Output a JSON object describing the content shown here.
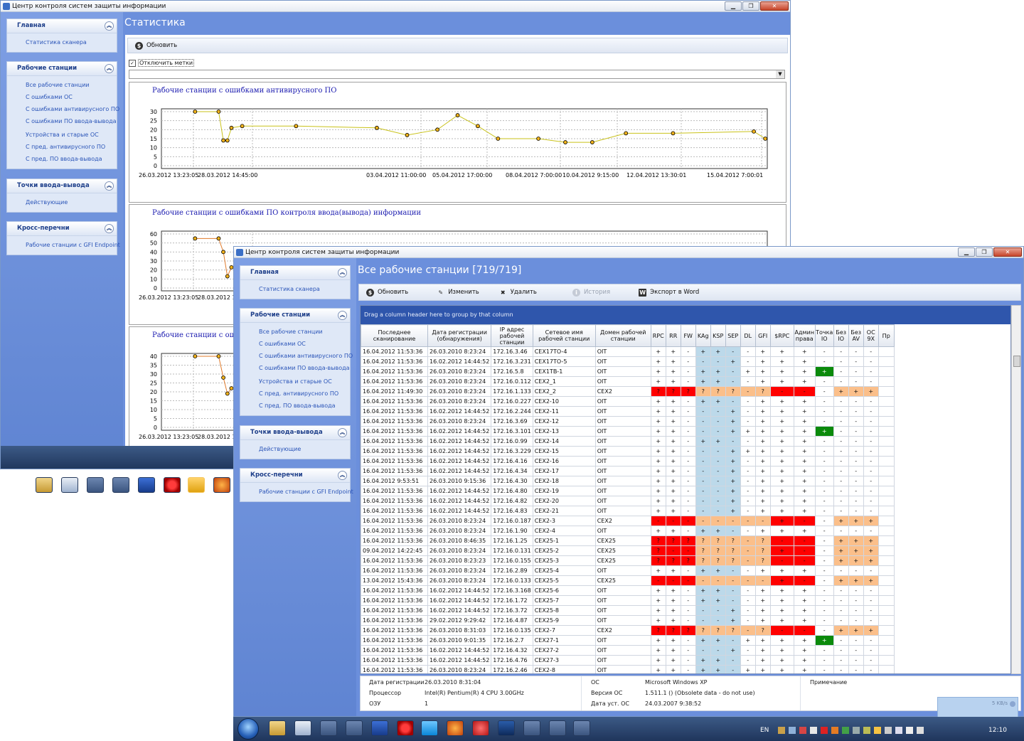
{
  "back_window": {
    "title": "Центр контроля систем защиты информации",
    "page_title": "Статистика",
    "toolbar": {
      "refresh": "Обновить"
    },
    "checkbox_label": "Отключить метки",
    "charts": [
      {
        "title": "Рабочие станции с ошибками антивирусного ПО",
        "y_ticks": [
          "30",
          "25",
          "20",
          "15",
          "10",
          "5",
          "0"
        ],
        "x_labels": [
          "26.03.2012 13:23:05",
          "28.03.2012 14:45:00",
          "03.04.2012 11:00:00",
          "05.04.2012 17:00:00",
          "08.04.2012 7:00:00",
          "10.04.2012 9:15:00",
          "12.04.2012 13:30:01",
          "15.04.2012 7:00:01"
        ]
      },
      {
        "title": "Рабочие станции с ошибками ПО контроля ввода(вывода) информации",
        "y_ticks": [
          "60",
          "50",
          "40",
          "30",
          "20",
          "10",
          "0"
        ],
        "x_labels": [
          "26.03.2012 13:23:05",
          "28.03.2012 14:4"
        ]
      },
      {
        "title": "Рабочие станции с ошиб",
        "y_ticks": [
          "40",
          "35",
          "30",
          "25",
          "20",
          "15",
          "10",
          "5",
          "0"
        ],
        "x_labels": [
          "26.03.2012 13:23:05",
          "28.03.2012 14:4"
        ]
      }
    ]
  },
  "sidebar": {
    "groups": [
      {
        "title": "Главная",
        "items": [
          "Статистика сканера"
        ]
      },
      {
        "title": "Рабочие станции",
        "items": [
          "Все рабочие станции",
          "С ошибками ОС",
          "С ошибками антивирусного ПО",
          "С ошибками ПО ввода-вывода",
          "Устройства и старые ОС",
          "С пред. антивирусного ПО",
          "С пред. ПО ввода-вывода"
        ]
      },
      {
        "title": "Точки ввода-вывода",
        "items": [
          "Действующие"
        ]
      },
      {
        "title": "Кросс-перечни",
        "items": [
          "Рабочие станции с GFI Endpoint"
        ]
      }
    ]
  },
  "front_window": {
    "title": "Центр контроля систем защиты информации",
    "page_title": "Все рабочие станции [719/719]",
    "toolbar": {
      "refresh": "Обновить",
      "edit": "Изменить",
      "delete": "Удалить",
      "history": "История",
      "export": "Экспорт в Word"
    },
    "group_hint": "Drag a column header here to group by that column",
    "columns": [
      "Последнее сканирование",
      "Дата регистрации (обнаружения)",
      "IP адрес рабочей станции",
      "Сетевое имя рабочей станции",
      "Домен рабочей станции",
      "RPC",
      "RR",
      "FW",
      "KAg",
      "KSP",
      "SEP",
      "DL",
      "GFI",
      "$RPC",
      "Админ права",
      "Точка IO",
      "Без IO",
      "Без AV",
      "ОС 9X",
      "Пр"
    ],
    "rows": [
      [
        "16.04.2012 11:53:36",
        "26.03.2010 8:23:24",
        "172.16.3.46",
        "CEX17TO-4",
        "OIT",
        "+",
        "+",
        "-",
        "+",
        "+",
        "-",
        "-",
        "+",
        "+",
        "+",
        "-",
        "-",
        "-",
        "-",
        "",
        "n"
      ],
      [
        "16.04.2012 11:53:36",
        "16.02.2012 14:44:52",
        "172.16.3.231",
        "CEX17TO-5",
        "OIT",
        "+",
        "+",
        "-",
        "-",
        "-",
        "+",
        "-",
        "+",
        "+",
        "+",
        "-",
        "-",
        "-",
        "-",
        "",
        "n"
      ],
      [
        "16.04.2012 11:53:36",
        "26.03.2010 8:23:24",
        "172.16.5.8",
        "CEX1TB-1",
        "OIT",
        "+",
        "+",
        "-",
        "+",
        "+",
        "-",
        "+",
        "+",
        "+",
        "+",
        "+",
        "-",
        "-",
        "-",
        "",
        "g"
      ],
      [
        "16.04.2012 11:53:36",
        "26.03.2010 8:23:24",
        "172.16.0.112",
        "CEX2_1",
        "OIT",
        "+",
        "+",
        "-",
        "+",
        "+",
        "-",
        "-",
        "+",
        "+",
        "+",
        "-",
        "-",
        "-",
        "-",
        "",
        "n"
      ],
      [
        "16.04.2012 11:49:30",
        "26.03.2010 8:23:24",
        "172.16.1.133",
        "CEX2_2",
        "CEX2",
        "?",
        "?",
        "?",
        "?",
        "?",
        "?",
        "-",
        "?",
        "-",
        "-",
        "-",
        "+",
        "+",
        "+",
        "",
        "r"
      ],
      [
        "16.04.2012 11:53:36",
        "26.03.2010 8:23:24",
        "172.16.0.227",
        "CEX2-10",
        "OIT",
        "+",
        "+",
        "-",
        "+",
        "+",
        "-",
        "-",
        "+",
        "+",
        "+",
        "-",
        "-",
        "-",
        "-",
        "",
        "n"
      ],
      [
        "16.04.2012 11:53:36",
        "16.02.2012 14:44:52",
        "172.16.2.244",
        "CEX2-11",
        "OIT",
        "+",
        "+",
        "-",
        "-",
        "-",
        "+",
        "-",
        "+",
        "+",
        "+",
        "-",
        "-",
        "-",
        "-",
        "",
        "n"
      ],
      [
        "16.04.2012 11:53:36",
        "26.03.2010 8:23:24",
        "172.16.3.69",
        "CEX2-12",
        "OIT",
        "+",
        "+",
        "-",
        "-",
        "-",
        "+",
        "-",
        "+",
        "+",
        "+",
        "-",
        "-",
        "-",
        "-",
        "",
        "n"
      ],
      [
        "16.04.2012 11:53:36",
        "16.02.2012 14:44:52",
        "172.16.3.101",
        "CEX2-13",
        "OIT",
        "+",
        "+",
        "-",
        "-",
        "-",
        "+",
        "+",
        "+",
        "+",
        "+",
        "+",
        "-",
        "-",
        "-",
        "",
        "g"
      ],
      [
        "16.04.2012 11:53:36",
        "16.02.2012 14:44:52",
        "172.16.0.99",
        "CEX2-14",
        "OIT",
        "+",
        "+",
        "-",
        "+",
        "+",
        "-",
        "-",
        "+",
        "+",
        "+",
        "-",
        "-",
        "-",
        "-",
        "",
        "n"
      ],
      [
        "16.04.2012 11:53:36",
        "16.02.2012 14:44:52",
        "172.16.3.229",
        "CEX2-15",
        "OIT",
        "+",
        "+",
        "-",
        "-",
        "-",
        "+",
        "+",
        "+",
        "+",
        "+",
        "-",
        "-",
        "-",
        "-",
        "",
        "n"
      ],
      [
        "16.04.2012 11:53:36",
        "16.02.2012 14:44:52",
        "172.16.4.16",
        "CEX2-16",
        "OIT",
        "+",
        "+",
        "-",
        "-",
        "-",
        "+",
        "-",
        "+",
        "+",
        "+",
        "-",
        "-",
        "-",
        "-",
        "",
        "n"
      ],
      [
        "16.04.2012 11:53:36",
        "16.02.2012 14:44:52",
        "172.16.4.34",
        "CEX2-17",
        "OIT",
        "+",
        "+",
        "-",
        "-",
        "-",
        "+",
        "-",
        "+",
        "+",
        "+",
        "-",
        "-",
        "-",
        "-",
        "",
        "n"
      ],
      [
        "16.04.2012 9:53:51",
        "26.03.2010 9:15:36",
        "172.16.4.30",
        "CEX2-18",
        "OIT",
        "+",
        "+",
        "-",
        "-",
        "-",
        "+",
        "-",
        "+",
        "+",
        "+",
        "-",
        "-",
        "-",
        "-",
        "",
        "n"
      ],
      [
        "16.04.2012 11:53:36",
        "16.02.2012 14:44:52",
        "172.16.4.80",
        "CEX2-19",
        "OIT",
        "+",
        "+",
        "-",
        "-",
        "-",
        "+",
        "-",
        "+",
        "+",
        "+",
        "-",
        "-",
        "-",
        "-",
        "",
        "n"
      ],
      [
        "16.04.2012 11:53:36",
        "16.02.2012 14:44:52",
        "172.16.4.82",
        "CEX2-20",
        "OIT",
        "+",
        "+",
        "-",
        "-",
        "-",
        "+",
        "-",
        "+",
        "+",
        "+",
        "-",
        "-",
        "-",
        "-",
        "",
        "n"
      ],
      [
        "16.04.2012 11:53:36",
        "16.02.2012 14:44:52",
        "172.16.4.83",
        "CEX2-21",
        "OIT",
        "+",
        "+",
        "-",
        "-",
        "-",
        "+",
        "-",
        "+",
        "+",
        "+",
        "-",
        "-",
        "-",
        "-",
        "",
        "n"
      ],
      [
        "16.04.2012 11:53:36",
        "26.03.2010 8:23:24",
        "172.16.0.187",
        "CEX2-3",
        "CEX2",
        "-",
        "-",
        "-",
        "-",
        "-",
        "-",
        "-",
        "-",
        "+",
        "-",
        "-",
        "+",
        "+",
        "+",
        "",
        "r"
      ],
      [
        "16.04.2012 11:53:36",
        "26.03.2010 8:23:24",
        "172.16.1.90",
        "CEX2-4",
        "OIT",
        "+",
        "+",
        "-",
        "+",
        "+",
        "-",
        "-",
        "+",
        "+",
        "+",
        "-",
        "-",
        "-",
        "-",
        "",
        "n"
      ],
      [
        "16.04.2012 11:53:36",
        "26.03.2010 8:46:35",
        "172.16.1.25",
        "CEX25-1",
        "CEX25",
        "?",
        "?",
        "?",
        "?",
        "?",
        "?",
        "-",
        "?",
        "-",
        "-",
        "-",
        "+",
        "+",
        "+",
        "",
        "r"
      ],
      [
        "09.04.2012 14:22:45",
        "26.03.2010 8:23:24",
        "172.16.0.131",
        "CEX25-2",
        "CEX25",
        "?",
        "-",
        "-",
        "?",
        "?",
        "?",
        "-",
        "?",
        "+",
        "-",
        "-",
        "+",
        "+",
        "+",
        "",
        "r"
      ],
      [
        "16.04.2012 11:53:36",
        "26.03.2010 8:23:23",
        "172.16.0.155",
        "CEX25-3",
        "CEX25",
        "?",
        "?",
        "?",
        "?",
        "?",
        "?",
        "-",
        "?",
        "-",
        "-",
        "-",
        "+",
        "+",
        "+",
        "",
        "r"
      ],
      [
        "16.04.2012 11:53:36",
        "26.03.2010 8:23:24",
        "172.16.2.89",
        "CEX25-4",
        "OIT",
        "+",
        "+",
        "-",
        "+",
        "+",
        "-",
        "-",
        "+",
        "+",
        "+",
        "-",
        "-",
        "-",
        "-",
        "",
        "n"
      ],
      [
        "13.04.2012 15:43:36",
        "26.03.2010 8:23:24",
        "172.16.0.133",
        "CEX25-5",
        "CEX25",
        "-",
        "-",
        "-",
        "-",
        "-",
        "-",
        "-",
        "-",
        "+",
        "-",
        "-",
        "+",
        "+",
        "+",
        "",
        "r"
      ],
      [
        "16.04.2012 11:53:36",
        "16.02.2012 14:44:52",
        "172.16.3.168",
        "CEX25-6",
        "OIT",
        "+",
        "+",
        "-",
        "+",
        "+",
        "-",
        "-",
        "+",
        "+",
        "+",
        "-",
        "-",
        "-",
        "-",
        "",
        "n"
      ],
      [
        "16.04.2012 11:53:36",
        "16.02.2012 14:44:52",
        "172.16.1.72",
        "CEX25-7",
        "OIT",
        "+",
        "+",
        "-",
        "+",
        "+",
        "-",
        "-",
        "+",
        "+",
        "+",
        "-",
        "-",
        "-",
        "-",
        "",
        "n"
      ],
      [
        "16.04.2012 11:53:36",
        "16.02.2012 14:44:52",
        "172.16.3.72",
        "CEX25-8",
        "OIT",
        "+",
        "+",
        "-",
        "-",
        "-",
        "+",
        "-",
        "+",
        "+",
        "+",
        "-",
        "-",
        "-",
        "-",
        "",
        "n"
      ],
      [
        "16.04.2012 11:53:36",
        "29.02.2012 9:29:42",
        "172.16.4.87",
        "CEX25-9",
        "OIT",
        "+",
        "+",
        "-",
        "-",
        "-",
        "+",
        "-",
        "+",
        "+",
        "+",
        "-",
        "-",
        "-",
        "-",
        "",
        "n"
      ],
      [
        "16.04.2012 11:53:36",
        "26.03.2010 8:31:03",
        "172.16.0.135",
        "CEX2-7",
        "CEX2",
        "?",
        "?",
        "?",
        "?",
        "?",
        "?",
        "-",
        "?",
        "-",
        "-",
        "-",
        "+",
        "+",
        "+",
        "",
        "r"
      ],
      [
        "16.04.2012 11:53:36",
        "26.03.2010 9:01:35",
        "172.16.2.7",
        "CEX27-1",
        "OIT",
        "+",
        "+",
        "-",
        "+",
        "+",
        "-",
        "+",
        "+",
        "+",
        "+",
        "+",
        "-",
        "-",
        "-",
        "",
        "g"
      ],
      [
        "16.04.2012 11:53:36",
        "16.02.2012 14:44:52",
        "172.16.4.32",
        "CEX27-2",
        "OIT",
        "+",
        "+",
        "-",
        "-",
        "-",
        "+",
        "-",
        "+",
        "+",
        "+",
        "-",
        "-",
        "-",
        "-",
        "",
        "n"
      ],
      [
        "16.04.2012 11:53:36",
        "16.02.2012 14:44:52",
        "172.16.4.76",
        "CEX27-3",
        "OIT",
        "+",
        "+",
        "-",
        "+",
        "+",
        "-",
        "-",
        "+",
        "+",
        "+",
        "-",
        "-",
        "-",
        "-",
        "",
        "n"
      ],
      [
        "16.04.2012 11:53:36",
        "26.03.2010 8:23:24",
        "172.16.2.46",
        "CEX2-8",
        "OIT",
        "+",
        "+",
        "-",
        "+",
        "+",
        "-",
        "+",
        "+",
        "+",
        "+",
        "-",
        "-",
        "-",
        "-",
        "",
        "n"
      ]
    ],
    "details": {
      "reg_label": "Дата регистрации",
      "reg_value": "26.03.2010 8:31:04",
      "cpu_label": "Процессор",
      "cpu_value": "Intel(R) Pentium(R) 4 CPU 3.00GHz",
      "ram_label": "ОЗУ",
      "ram_value": "1",
      "os_label": "ОС",
      "os_value": "Microsoft Windows XP",
      "osver_label": "Версия ОС",
      "osver_value": "1.511.1 () (Obsolete data - do not use)",
      "osdate_label": "Дата уст. ОС",
      "osdate_value": "24.03.2007 9:38:52",
      "note_label": "Примечание"
    }
  },
  "taskbar": {
    "lang": "EN",
    "clock": "12:10",
    "net_speed": "5 KB/s"
  },
  "colors": {
    "error": "#ff0000",
    "warn": "#fbbf8a",
    "ok": "#0b8a0b",
    "accent": "#6b8fdc"
  }
}
